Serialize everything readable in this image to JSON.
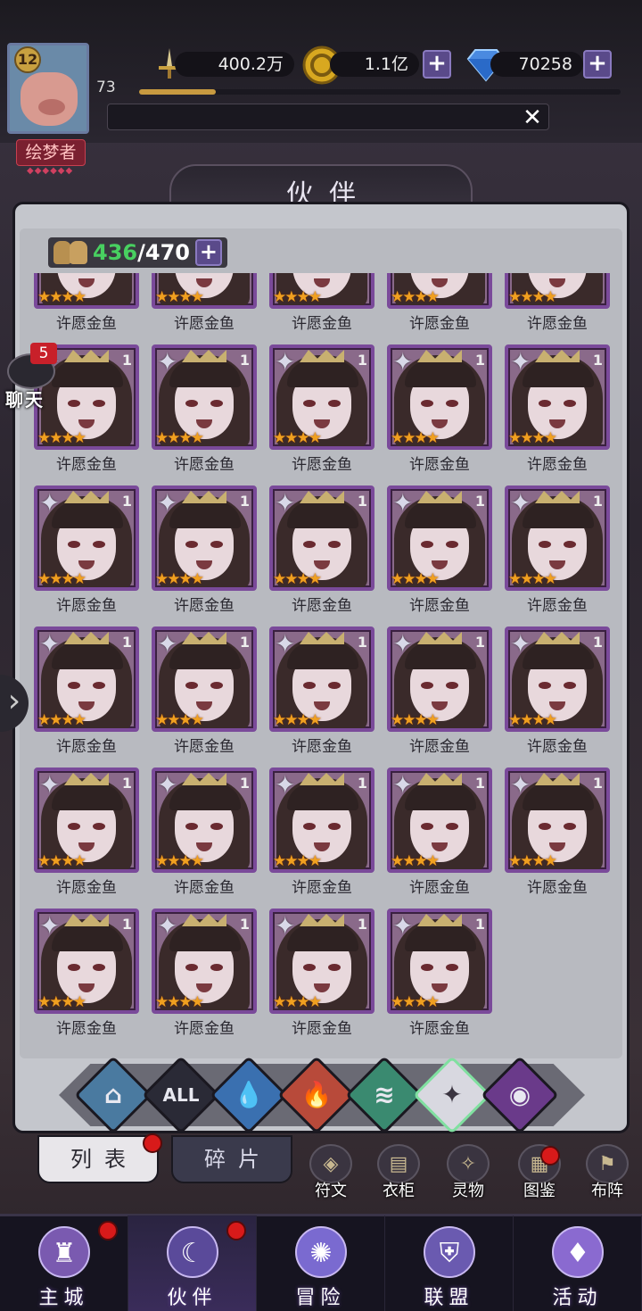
{
  "player": {
    "level": "12",
    "exp_value": "73",
    "exp_progress": 0.16,
    "title": "绘梦者",
    "title_dots": "◆◆◆◆◆◆"
  },
  "resources": {
    "power": "400.2万",
    "gold": "1.1亿",
    "diamond": "70258"
  },
  "header": {
    "title": "伙伴"
  },
  "partner_count": {
    "current": "436",
    "max": "/470"
  },
  "chat": {
    "badge": "5",
    "label": "聊天"
  },
  "partners": [
    {
      "name": "许愿金鱼",
      "stars": "★★★★"
    },
    {
      "name": "许愿金鱼",
      "stars": "★★★★"
    },
    {
      "name": "许愿金鱼",
      "stars": "★★★★"
    },
    {
      "name": "许愿金鱼",
      "stars": "★★★★"
    },
    {
      "name": "许愿金鱼",
      "stars": "★★★★"
    },
    {
      "name": "许愿金鱼",
      "stars": "★★★★"
    },
    {
      "name": "许愿金鱼",
      "stars": "★★★★"
    },
    {
      "name": "许愿金鱼",
      "stars": "★★★★"
    },
    {
      "name": "许愿金鱼",
      "stars": "★★★★"
    },
    {
      "name": "许愿金鱼",
      "stars": "★★★★"
    },
    {
      "name": "许愿金鱼",
      "stars": "★★★★"
    },
    {
      "name": "许愿金鱼",
      "stars": "★★★★"
    },
    {
      "name": "许愿金鱼",
      "stars": "★★★★"
    },
    {
      "name": "许愿金鱼",
      "stars": "★★★★"
    },
    {
      "name": "许愿金鱼",
      "stars": "★★★★"
    },
    {
      "name": "许愿金鱼",
      "stars": "★★★★"
    },
    {
      "name": "许愿金鱼",
      "stars": "★★★★"
    },
    {
      "name": "许愿金鱼",
      "stars": "★★★★"
    },
    {
      "name": "许愿金鱼",
      "stars": "★★★★"
    },
    {
      "name": "许愿金鱼",
      "stars": "★★★★"
    },
    {
      "name": "许愿金鱼",
      "stars": "★★★★"
    },
    {
      "name": "许愿金鱼",
      "stars": "★★★★"
    },
    {
      "name": "许愿金鱼",
      "stars": "★★★★"
    },
    {
      "name": "许愿金鱼",
      "stars": "★★★★"
    },
    {
      "name": "许愿金鱼",
      "stars": "★★★★"
    },
    {
      "name": "许愿金鱼",
      "stars": "★★★★"
    },
    {
      "name": "许愿金鱼",
      "stars": "★★★★"
    },
    {
      "name": "许愿金鱼",
      "stars": "★★★★"
    },
    {
      "name": "许愿金鱼",
      "stars": "★★★★"
    }
  ],
  "partner_level_tag": "1",
  "filters": [
    {
      "icon": "mountain-element-icon",
      "label": "",
      "color": "#4a7aa0"
    },
    {
      "icon": "all-filter-icon",
      "label": "ALL",
      "color": "#2a2a36"
    },
    {
      "icon": "water-element-icon",
      "label": "",
      "color": "#3a70b0"
    },
    {
      "icon": "fire-element-icon",
      "label": "",
      "color": "#b84a3a"
    },
    {
      "icon": "wind-element-icon",
      "label": "",
      "color": "#3a8a70"
    },
    {
      "icon": "light-star-icon",
      "label": "",
      "color": "#d8d8e0"
    },
    {
      "icon": "dark-eye-icon",
      "label": "",
      "color": "#6a3a8a"
    }
  ],
  "tabs": {
    "list": "列表",
    "fragments": "碎片"
  },
  "shortcuts": [
    {
      "label": "符文",
      "icon": "rune-icon",
      "dot": false
    },
    {
      "label": "衣柜",
      "icon": "wardrobe-icon",
      "dot": false
    },
    {
      "label": "灵物",
      "icon": "spirit-icon",
      "dot": false
    },
    {
      "label": "图鉴",
      "icon": "codex-icon",
      "dot": true
    },
    {
      "label": "布阵",
      "icon": "formation-icon",
      "dot": false
    }
  ],
  "nav": [
    {
      "label": "主城",
      "icon": "castle-icon",
      "dot": true
    },
    {
      "label": "伙伴",
      "icon": "partner-icon",
      "dot": true,
      "active": true
    },
    {
      "label": "冒险",
      "icon": "adventure-icon",
      "dot": false
    },
    {
      "label": "联盟",
      "icon": "alliance-shield-icon",
      "dot": false
    },
    {
      "label": "活动",
      "icon": "event-cards-icon",
      "dot": false
    }
  ]
}
